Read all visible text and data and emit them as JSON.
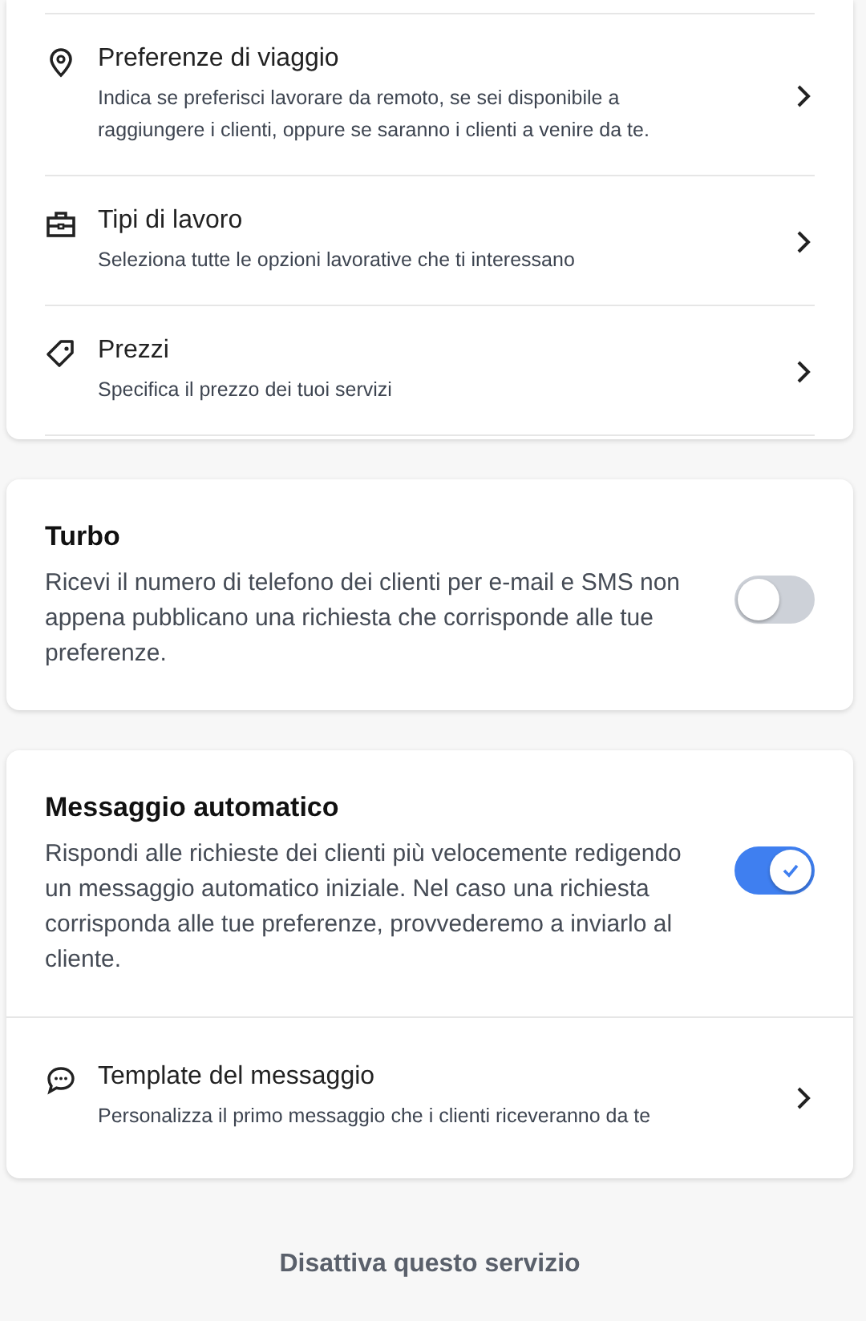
{
  "travel_settings": {
    "items": [
      {
        "title": "Preferenze di viaggio",
        "description": "Indica se preferisci lavorare da remoto, se sei disponibile a raggiungere i clienti, oppure se saranno i clienti a venire da te."
      },
      {
        "title": "Tipi di lavoro",
        "description": "Seleziona tutte le opzioni lavorative che ti interessano"
      },
      {
        "title": "Prezzi",
        "description": "Specifica il prezzo dei tuoi servizi"
      }
    ]
  },
  "turbo": {
    "title": "Turbo",
    "description": "Ricevi il numero di telefono dei clienti per e-mail e SMS non appena pubblicano una richiesta che corrisponde alle tue preferenze.",
    "on": false
  },
  "auto_message": {
    "title": "Messaggio automatico",
    "description": "Rispondi alle richieste dei clienti più velocemente redigendo un messaggio automatico iniziale. Nel caso una richiesta corrisponda alle tue preferenze, provvederemo a inviarlo al cliente.",
    "on": true,
    "items": [
      {
        "title": "Template del messaggio",
        "description": "Personalizza il primo messaggio che i clienti riceveranno da te"
      }
    ]
  },
  "footer_link": "Disattiva questo servizio"
}
